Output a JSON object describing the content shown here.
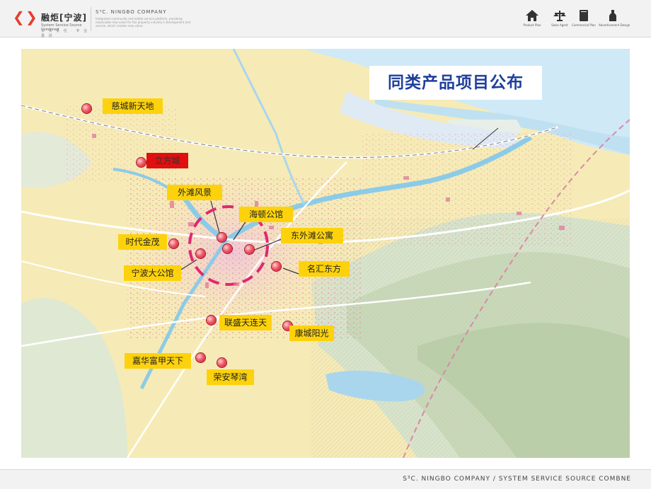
{
  "header": {
    "logo_cn": "融炬[宁波]",
    "logo_en": "System Service Source Combined",
    "logo_slogan": "求 实 责 任 · 专 业 勇 进",
    "company": "S³C. NINGBO COMPANY",
    "description": "Integrated community real estate service platform, providing reasonable new value for the property industry's development and service, which creates new value.",
    "nav": [
      {
        "label": "Product Plan",
        "icon": "house-icon"
      },
      {
        "label": "Sales Agent",
        "icon": "scale-icon"
      },
      {
        "label": "Commercial Plan",
        "icon": "book-icon"
      },
      {
        "label": "Advertisement Design",
        "icon": "bottle-icon"
      }
    ]
  },
  "title": "同类产品项目公布",
  "markers": [
    {
      "name": "慈城新天地",
      "style": "yellow"
    },
    {
      "name": "立方城",
      "style": "red"
    },
    {
      "name": "外滩风景",
      "style": "yellow"
    },
    {
      "name": "海顿公馆",
      "style": "yellow"
    },
    {
      "name": "东外滩公寓",
      "style": "yellow"
    },
    {
      "name": "时代金茂",
      "style": "yellow"
    },
    {
      "name": "宁波大公馆",
      "style": "yellow"
    },
    {
      "name": "名汇东方",
      "style": "yellow"
    },
    {
      "name": "联盛天连天",
      "style": "yellow"
    },
    {
      "name": "康城阳光",
      "style": "yellow"
    },
    {
      "name": "嘉华富甲天下",
      "style": "yellow"
    },
    {
      "name": "荣安琴湾",
      "style": "yellow"
    }
  ],
  "colors": {
    "label_bg": "#fdd20c",
    "label_highlight_bg": "#e10f10",
    "title_text": "#1f3f9c",
    "circle_dash": "#e0286e",
    "logo_accent": "#e63c2f"
  },
  "footer": {
    "text": "S³C. NINGBO COMPANY / SYSTEM SERVICE SOURCE COMBNE"
  }
}
